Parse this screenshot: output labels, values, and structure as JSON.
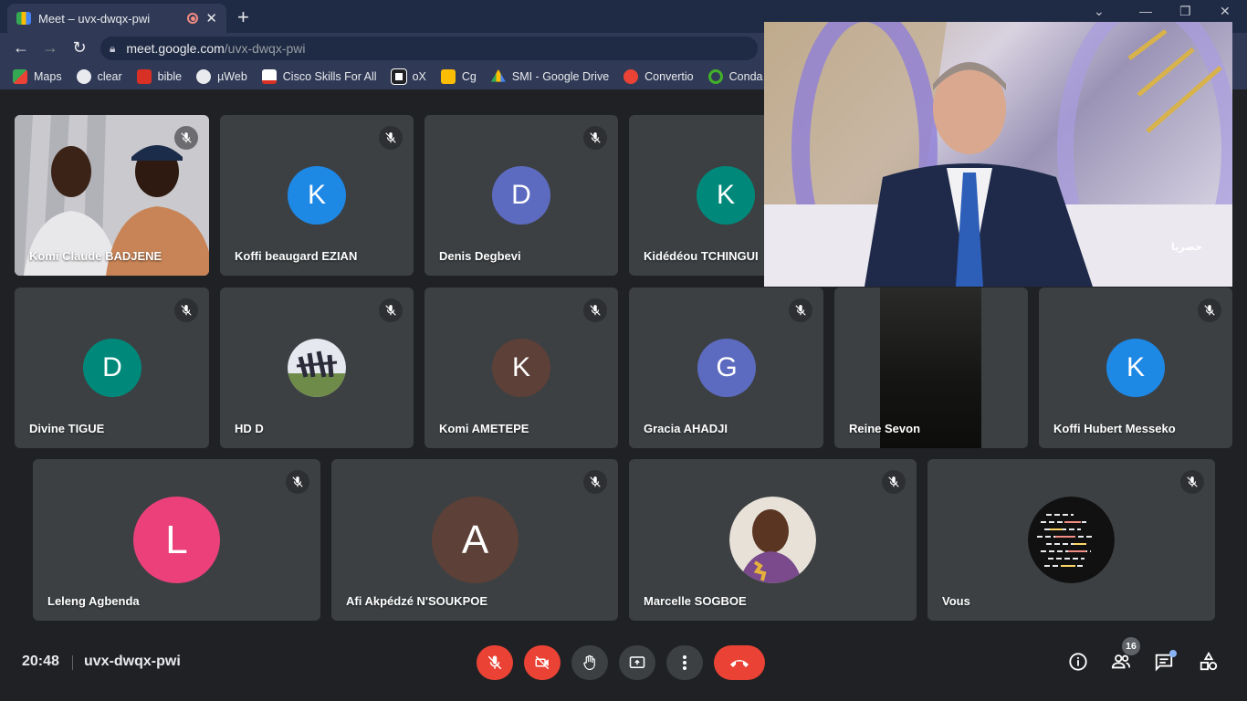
{
  "browser": {
    "tab_title": "Meet – uvx-dwqx-pwi",
    "url_host": "meet.google.com",
    "url_path": "/uvx-dwqx-pwi",
    "bookmarks": [
      {
        "label": "Maps",
        "icon": "maps-icon",
        "color": "#34a853"
      },
      {
        "label": "clear",
        "icon": "globe-icon",
        "color": "#e8eaed"
      },
      {
        "label": "bible",
        "icon": "bible-icon",
        "color": "#d93025"
      },
      {
        "label": "µWeb",
        "icon": "globe-icon",
        "color": "#e8eaed"
      },
      {
        "label": "Cisco Skills For All",
        "icon": "cisco-icon",
        "color": "#ffffff"
      },
      {
        "label": "oX",
        "icon": "ox-icon",
        "color": "#ffffff"
      },
      {
        "label": "Cg",
        "icon": "cg-icon",
        "color": "#fbbc04"
      },
      {
        "label": "SMI - Google Drive",
        "icon": "drive-icon",
        "color": "#4285f4"
      },
      {
        "label": "Convertio",
        "icon": "convertio-icon",
        "color": "#ea4335"
      },
      {
        "label": "Conda",
        "icon": "conda-icon",
        "color": "#43b02a"
      }
    ]
  },
  "participants": [
    {
      "name": "Komi Claude BADJENE",
      "initial": "",
      "color": "",
      "kind": "video"
    },
    {
      "name": "Koffi beaugard EZIAN",
      "initial": "K",
      "color": "#1e88e5"
    },
    {
      "name": "Denis Degbevi",
      "initial": "D",
      "color": "#5c6bc0"
    },
    {
      "name": "Kidédéou TCHINGUI",
      "initial": "K",
      "color": "#00897b"
    },
    {
      "name": "Divine TIGUE",
      "initial": "D",
      "color": "#00897b"
    },
    {
      "name": "HD D",
      "initial": "",
      "color": "",
      "kind": "photo"
    },
    {
      "name": "Komi AMETEPE",
      "initial": "K",
      "color": "#5d4037"
    },
    {
      "name": "Gracia AHADJI",
      "initial": "G",
      "color": "#5c6bc0"
    },
    {
      "name": "Reine Sevon",
      "initial": "",
      "color": "",
      "kind": "video"
    },
    {
      "name": "Koffi Hubert Messeko",
      "initial": "K",
      "color": "#1e88e5"
    },
    {
      "name": "Leleng Agbenda",
      "initial": "L",
      "color": "#ec407a"
    },
    {
      "name": "Afi Akpédzé N'SOUKPOE",
      "initial": "A",
      "color": "#5d4037"
    },
    {
      "name": "Marcelle SOGBOE",
      "initial": "",
      "color": "",
      "kind": "photo"
    },
    {
      "name": "Vous",
      "initial": "",
      "color": "",
      "kind": "photo"
    }
  ],
  "pip": {
    "overlay_text": "حصريا"
  },
  "bottom": {
    "time": "20:48",
    "meeting_code": "uvx-dwqx-pwi",
    "participant_count": "16"
  },
  "colors": {
    "accent_red": "#ea4335",
    "tile_bg": "#3c4043",
    "page_bg": "#202124"
  }
}
